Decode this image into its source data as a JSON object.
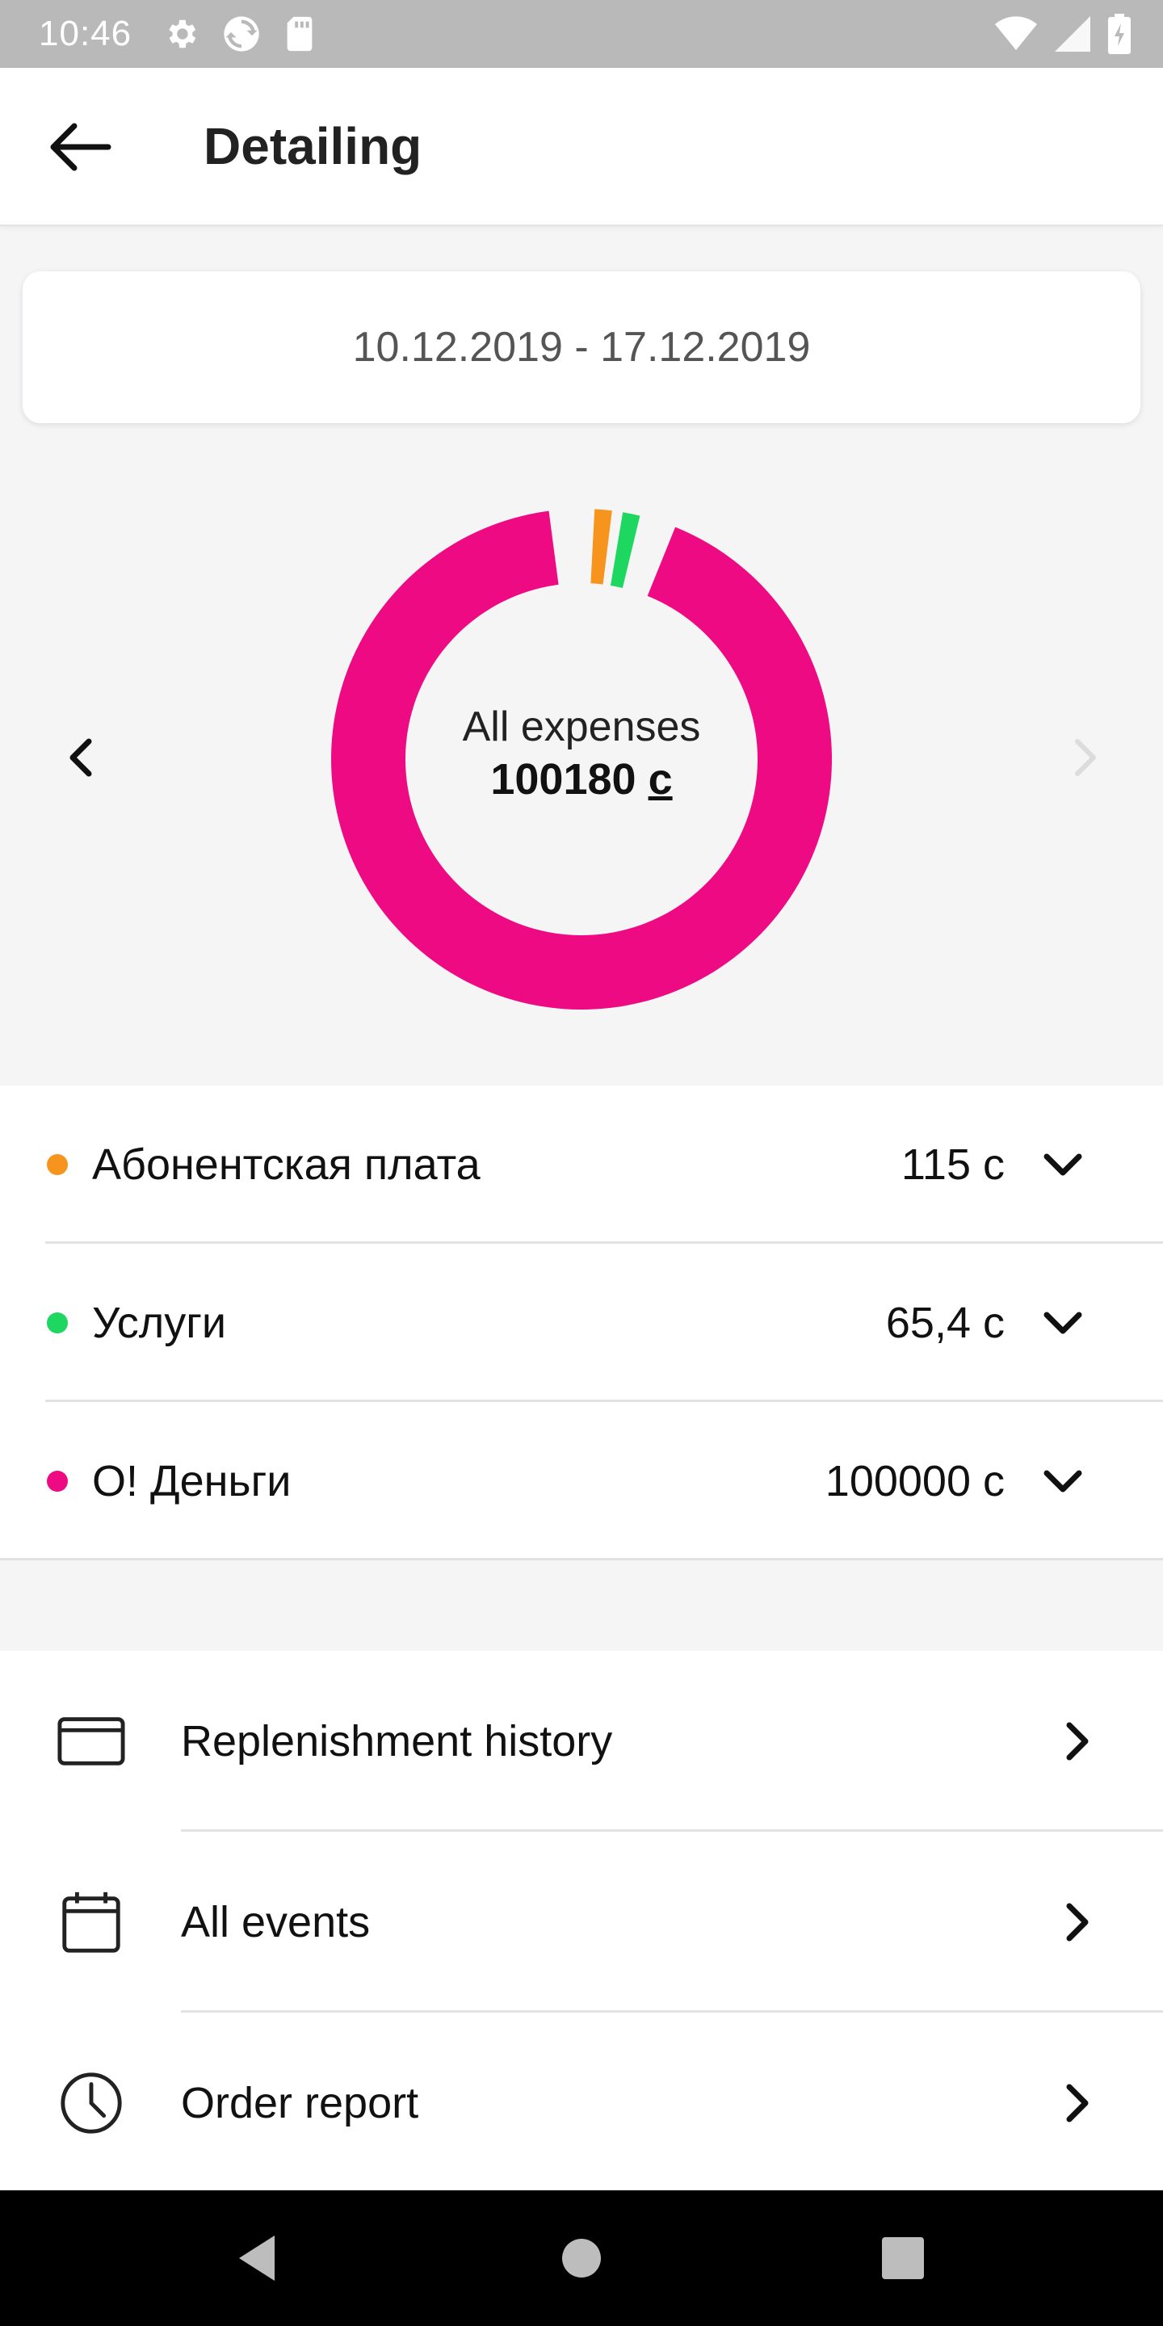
{
  "status_bar": {
    "time": "10:46",
    "icons": [
      "gear-icon",
      "sync-icon",
      "sd-card-icon",
      "wifi-icon",
      "signal-icon",
      "battery-icon"
    ]
  },
  "app_bar": {
    "title": "Detailing",
    "back_icon": "arrow-left-icon"
  },
  "date_range": "10.12.2019 - 17.12.2019",
  "chart": {
    "center_label": "All expenses",
    "total_value": "100180",
    "currency": "с"
  },
  "chart_data": {
    "type": "pie",
    "categories": [
      "Абонентская плата",
      "Услуги",
      "О! Деньги"
    ],
    "values": [
      115,
      65.4,
      100000
    ],
    "colors": [
      "#f7941d",
      "#1ed760",
      "#ee0a82"
    ]
  },
  "categories": [
    {
      "name": "Абонентская плата",
      "amount": "115 с",
      "color": "#f7941d"
    },
    {
      "name": "Услуги",
      "amount": "65,4 с",
      "color": "#1ed760"
    },
    {
      "name": "О! Деньги",
      "amount": "100000 с",
      "color": "#ee0a82"
    }
  ],
  "menu": [
    {
      "label": "Replenishment history",
      "icon": "credit-card-icon"
    },
    {
      "label": "All events",
      "icon": "calendar-icon"
    },
    {
      "label": "Order report",
      "icon": "clock-icon"
    }
  ],
  "colors": {
    "accent": "#ee0a82",
    "orange": "#f7941d",
    "green": "#1ed760"
  }
}
